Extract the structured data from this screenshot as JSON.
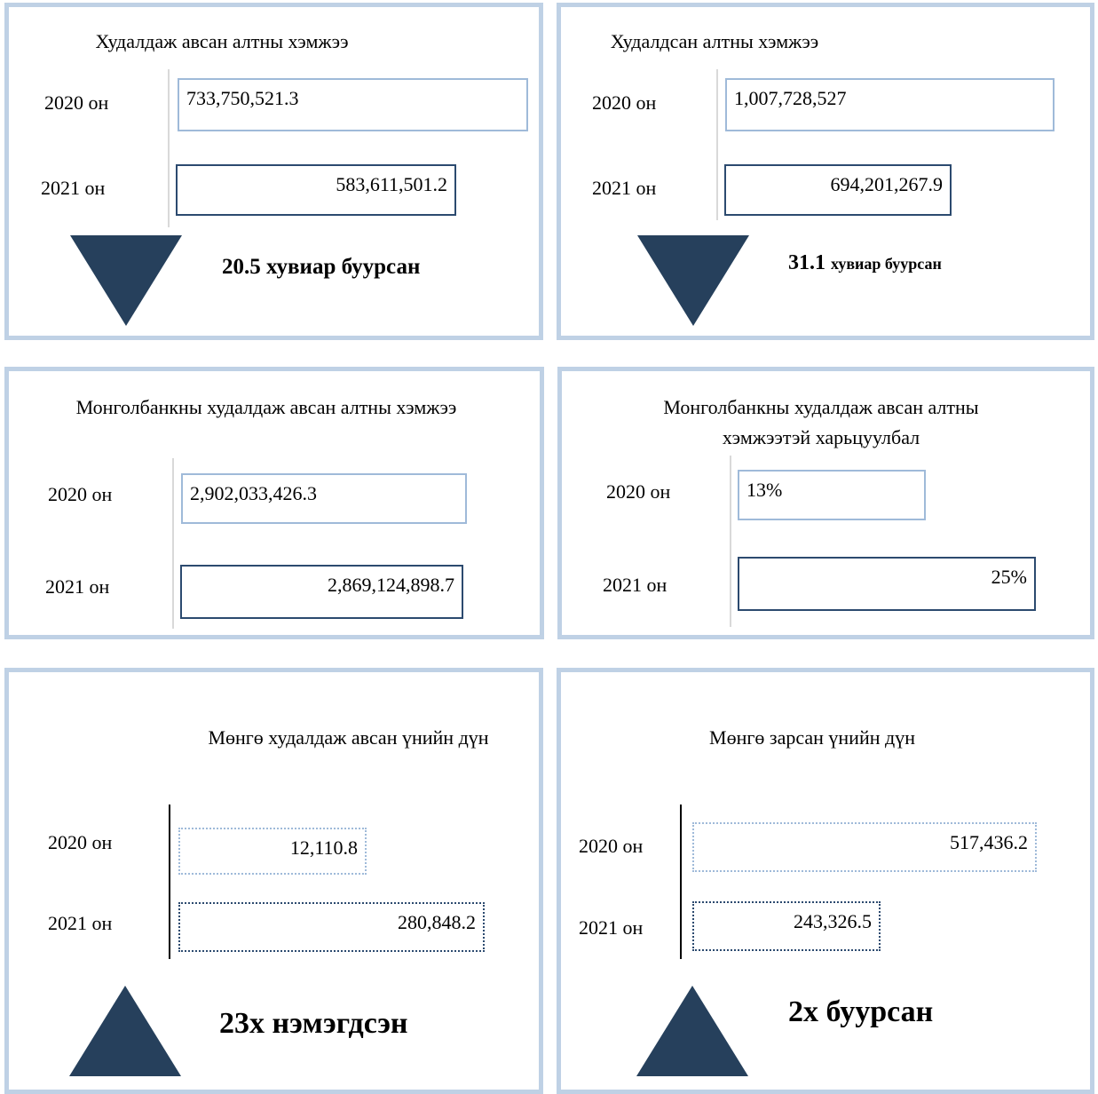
{
  "colors": {
    "panel_border": "#bfd1e5",
    "bar_2020": "#9fbad9",
    "bar_2021": "#2c4a6f",
    "arrow": "#26405c"
  },
  "chart_data": [
    {
      "type": "bar",
      "title": "Худалдаж авсан алтны хэмжээ",
      "categories": [
        "2020 он",
        "2021 он"
      ],
      "values": [
        733750521.3,
        583611501.2
      ],
      "value_labels": [
        "733,750,521.3",
        "583,611,501.2"
      ],
      "annotation": {
        "direction": "down",
        "number": "20.5",
        "text": "хувиар буурсан"
      }
    },
    {
      "type": "bar",
      "title": "Худалдсан алтны хэмжээ",
      "categories": [
        "2020 он",
        "2021 он"
      ],
      "values": [
        1007728527,
        694201267.9
      ],
      "value_labels": [
        "1,007,728,527",
        "694,201,267.9"
      ],
      "annotation": {
        "direction": "down",
        "number": "31.1",
        "text": "хувиар буурсан"
      }
    },
    {
      "type": "bar",
      "title": "Монголбанкны худалдаж авсан алтны хэмжээ",
      "categories": [
        "2020 он",
        "2021 он"
      ],
      "values": [
        2902033426.3,
        2869124898.7
      ],
      "value_labels": [
        "2,902,033,426.3",
        "2,869,124,898.7"
      ]
    },
    {
      "type": "bar",
      "title": "Монголбанкны худалдаж авсан алтны хэмжээтэй харьцуулбал",
      "categories": [
        "2020 он",
        "2021 он"
      ],
      "values": [
        13,
        25
      ],
      "value_labels": [
        "13%",
        "25%"
      ]
    },
    {
      "type": "bar",
      "title": "Мөнгө худалдаж авсан үнийн дүн",
      "categories": [
        "2020 он",
        "2021 он"
      ],
      "values": [
        12110.8,
        280848.2
      ],
      "value_labels": [
        "12,110.8",
        "280,848.2"
      ],
      "annotation": {
        "direction": "up",
        "number": "",
        "text": "23х нэмэгдсэн"
      }
    },
    {
      "type": "bar",
      "title": "Мөнгө зарсан үнийн дүн",
      "categories": [
        "2020 он",
        "2021 он"
      ],
      "values": [
        517436.2,
        243326.5
      ],
      "value_labels": [
        "517,436.2",
        "243,326.5"
      ],
      "annotation": {
        "direction": "up",
        "number": "",
        "text": "2х буурсан"
      }
    }
  ]
}
